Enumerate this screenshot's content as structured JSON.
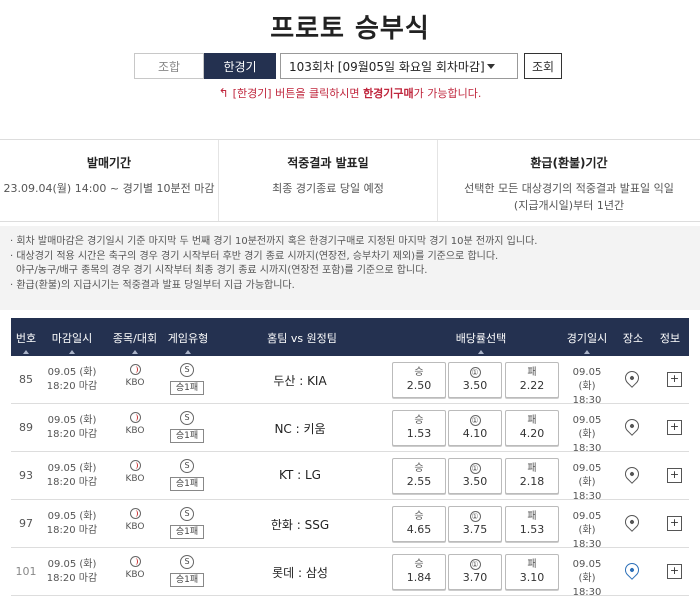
{
  "page": {
    "title": "프로토 승부식"
  },
  "controls": {
    "tab_combo": "조합",
    "tab_single": "한경기",
    "round_select": "103회차 [09월05일 화요일 회차마감]",
    "search_btn": "조회"
  },
  "notice": {
    "arrow": "↰",
    "prefix": "[한경기] 버튼을 클릭하시면 ",
    "highlight": "한경기구매",
    "suffix": "가 가능합니다."
  },
  "info": [
    {
      "head": "발매기간",
      "body": "23.09.04(월) 14:00 ~ 경기별 10분전 마감"
    },
    {
      "head": "적중결과 발표일",
      "body": "최종 경기종료 당일 예정"
    },
    {
      "head": "환급(환불)기간",
      "body": "선택한 모든 대상경기의 적중결과 발표일 익일(지급개시일)부터 1년간"
    }
  ],
  "notes": [
    "· 회차 발매마감은 경기일시 기준 마지막 두 번째 경기 10분전까지 혹은 한경기구매로 지정된 마지막 경기 10분 전까지 입니다.",
    "· 대상경기 적용 시간은 축구의 경우 경기 시작부터 후반 경기 종료 시까지(연장전, 승부차기 제외)를 기준으로 합니다.",
    "  야구/농구/배구 종목의 경우 경기 시작부터 최종 경기 종료 시까지(연장전 포함)를 기준으로 합니다.",
    "· 환급(환불)의 지급시기는 적중결과 발표 당일부터 지급 가능합니다."
  ],
  "table": {
    "headers": {
      "no": "번호",
      "deadline": "마감일시",
      "sport": "종목/대회",
      "type": "게임유형",
      "teams": "홈팀 vs 원정팀",
      "odds": "배당률선택",
      "game_date": "경기일시",
      "venue": "장소",
      "info": "정보"
    },
    "rows": [
      {
        "no": "85",
        "deadline_date": "09.05 (화)",
        "deadline_time": "18:20 마감",
        "league": "KBO",
        "type_icon": "S",
        "type_label": "승1패",
        "teams": "두산 : KIA",
        "win_label": "승",
        "win": "2.50",
        "draw_label": "①",
        "draw": "3.50",
        "lose_label": "패",
        "lose": "2.22",
        "game_date": "09.05 (화)",
        "game_time": "18:30",
        "plus": "+"
      },
      {
        "no": "89",
        "deadline_date": "09.05 (화)",
        "deadline_time": "18:20 마감",
        "league": "KBO",
        "type_icon": "S",
        "type_label": "승1패",
        "teams": "NC : 키움",
        "win_label": "승",
        "win": "1.53",
        "draw_label": "①",
        "draw": "4.10",
        "lose_label": "패",
        "lose": "4.20",
        "game_date": "09.05 (화)",
        "game_time": "18:30",
        "plus": "+"
      },
      {
        "no": "93",
        "deadline_date": "09.05 (화)",
        "deadline_time": "18:20 마감",
        "league": "KBO",
        "type_icon": "S",
        "type_label": "승1패",
        "teams": "KT : LG",
        "win_label": "승",
        "win": "2.55",
        "draw_label": "①",
        "draw": "3.50",
        "lose_label": "패",
        "lose": "2.18",
        "game_date": "09.05 (화)",
        "game_time": "18:30",
        "plus": "+"
      },
      {
        "no": "97",
        "deadline_date": "09.05 (화)",
        "deadline_time": "18:20 마감",
        "league": "KBO",
        "type_icon": "S",
        "type_label": "승1패",
        "teams": "한화 : SSG",
        "win_label": "승",
        "win": "4.65",
        "draw_label": "①",
        "draw": "3.75",
        "lose_label": "패",
        "lose": "1.53",
        "game_date": "09.05 (화)",
        "game_time": "18:30",
        "plus": "+"
      },
      {
        "no": "101",
        "deadline_date": "09.05 (화)",
        "deadline_time": "18:20 마감",
        "league": "KBO",
        "type_icon": "S",
        "type_label": "승1패",
        "teams": "롯데 : 삼성",
        "win_label": "승",
        "win": "1.84",
        "draw_label": "①",
        "draw": "3.70",
        "lose_label": "패",
        "lose": "3.10",
        "game_date": "09.05 (화)",
        "game_time": "18:30",
        "plus": "+"
      }
    ]
  },
  "colors": {
    "header_bg": "#243150",
    "accent_red": "#c0273e",
    "pin_blue": "#2b6fb8"
  }
}
